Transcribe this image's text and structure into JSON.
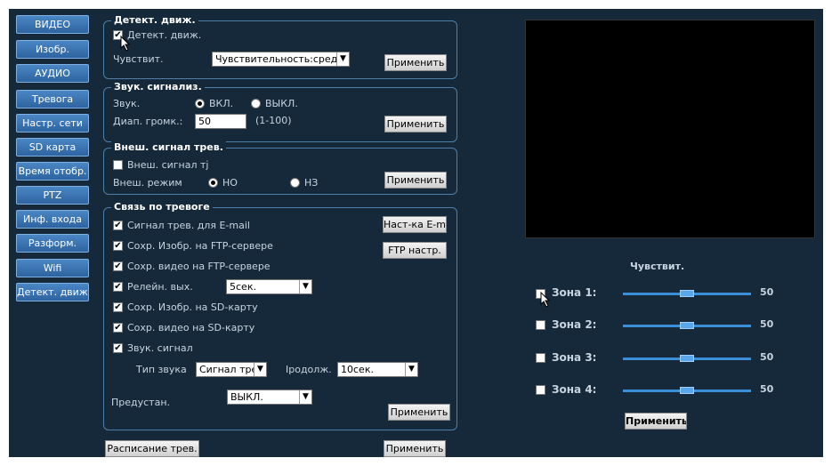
{
  "nav": {
    "items": [
      {
        "label": "ВИДЕО"
      },
      {
        "label": "Изобр."
      },
      {
        "label": "АУДИО"
      },
      {
        "label": "Тревога"
      },
      {
        "label": "Настр. сети"
      },
      {
        "label": "SD карта"
      },
      {
        "label": "Время отобр."
      },
      {
        "label": "PTZ"
      },
      {
        "label": "Инф. входа"
      },
      {
        "label": "Разформ."
      },
      {
        "label": "Wifi"
      },
      {
        "label": "Детект. движ."
      }
    ]
  },
  "motion": {
    "legend": "Детект. движ.",
    "enable_label": "Детект. движ.",
    "enable_checked": true,
    "sens_label": "Чувствит.",
    "sens_value": "Чувствительность:средняя",
    "apply": "Применить"
  },
  "sound": {
    "legend": "Звук. сигнализ.",
    "sound_label": "Звук.",
    "on_label": "ВКЛ.",
    "off_label": "ВЫКЛ.",
    "selected": "on",
    "range_label": "Диап. громк.:",
    "range_value": "50",
    "range_hint": "(1-100)",
    "apply": "Применить"
  },
  "external": {
    "legend": "Внеш. сигнал трев.",
    "enable_label": "Внеш. сигнал тј",
    "mode_label": "Внеш. режим",
    "no_label": "НО",
    "nc_label": "НЗ",
    "selected": "no",
    "apply": "Применить"
  },
  "alarm": {
    "legend": "Связь по тревоге",
    "email_label": "Сигнал трев. для  E-mail",
    "email_btn": "Наст-ка E-mail",
    "ftp_img_label": "Сохр. Изобр. на FTP-сервере",
    "ftp_btn": "FTP настр.",
    "ftp_video_label": "Сохр. видео на FTP-сервере",
    "relay_label": "Релейн. вых.",
    "relay_value": "5сек.",
    "sd_img_label": "Сохр. Изобр. на SD-карту",
    "sd_video_label": "Сохр. видео на SD-карту",
    "sound_label": "Звук. сигнал",
    "sound_type_label": "Тип звука",
    "sound_type_value": "Сигнал трев",
    "duration_label": "Іродолж.",
    "duration_value": "10сек.",
    "preset_label": "Предустан.",
    "preset_value": "ВЫКЛ.",
    "apply": "Применить"
  },
  "bottom": {
    "schedule_btn": "Расписание трев.",
    "apply": "Применить"
  },
  "zones": {
    "title": "Чувствит.",
    "items": [
      {
        "label": "Зона 1:",
        "value": "50",
        "checked": false,
        "level": 0.5
      },
      {
        "label": "Зона 2:",
        "value": "50",
        "checked": false,
        "level": 0.5
      },
      {
        "label": "Зона 3:",
        "value": "50",
        "checked": false,
        "level": 0.5
      },
      {
        "label": "Зона 4:",
        "value": "50",
        "checked": false,
        "level": 0.5
      }
    ],
    "apply": "Применить"
  },
  "icons": {
    "check": "checkmark-icon",
    "dropdown": "chevron-down-icon",
    "cursor": "mouse-pointer-icon"
  }
}
